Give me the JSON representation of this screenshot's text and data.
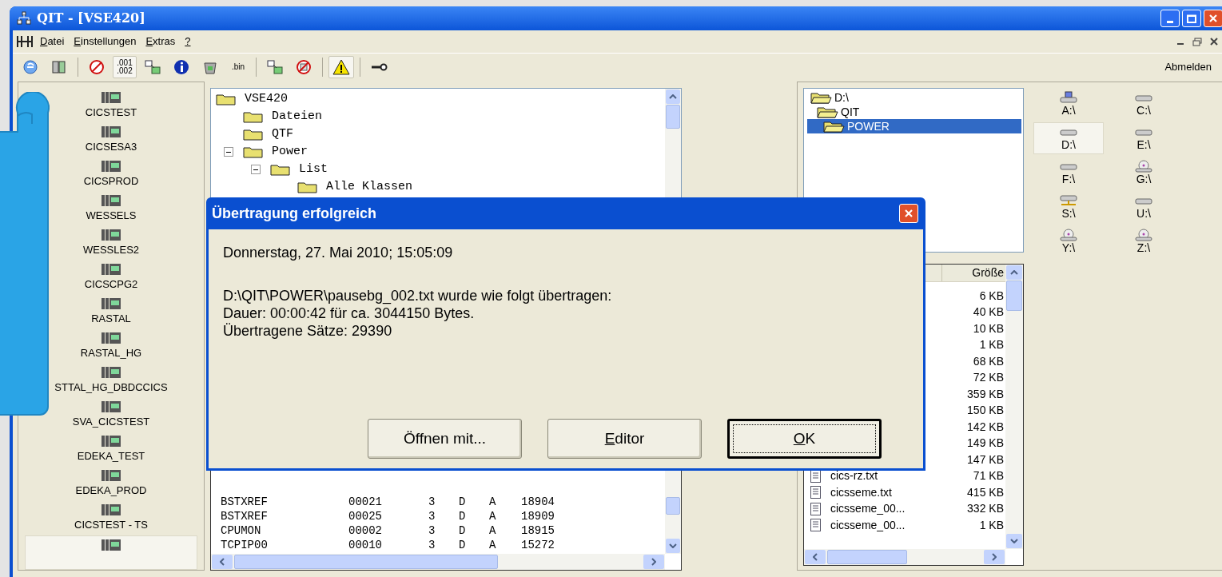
{
  "window": {
    "title": "QIT - [VSE420]"
  },
  "menu": [
    {
      "key": "D",
      "rest": "atei"
    },
    {
      "key": "E",
      "rest": "instellungen"
    },
    {
      "key": "E",
      "rest": "xtras"
    },
    {
      "key": "?"
    }
  ],
  "toolbar": [
    {
      "kind": "icon",
      "pressed": false
    },
    {
      "kind": "icon",
      "pressed": false
    },
    {
      "kind": "separator"
    },
    {
      "kind": "icon",
      "pressed": false
    },
    {
      "kind": "text",
      "label": ".001\n.002",
      "pressed": true
    },
    {
      "kind": "icon",
      "pressed": false
    },
    {
      "kind": "icon",
      "pressed": false
    },
    {
      "kind": "icon",
      "pressed": false
    },
    {
      "kind": "text",
      "label": ".bin",
      "pressed": false
    },
    {
      "kind": "separator"
    },
    {
      "kind": "icon",
      "pressed": false
    },
    {
      "kind": "icon",
      "pressed": false
    },
    {
      "kind": "separator"
    },
    {
      "kind": "icon",
      "pressed": true
    },
    {
      "kind": "separator"
    },
    {
      "kind": "icon",
      "pressed": false
    }
  ],
  "logout": "Abmelden",
  "systems": [
    {
      "label": "CICSTEST",
      "selected": false
    },
    {
      "label": "CICSESA3",
      "selected": false
    },
    {
      "label": "CICSPROD",
      "selected": false
    },
    {
      "label": "WESSELS",
      "selected": false
    },
    {
      "label": "WESSLES2",
      "selected": false
    },
    {
      "label": "CICSCPG2",
      "selected": false
    },
    {
      "label": "RASTAL",
      "selected": false
    },
    {
      "label": "RASTAL_HG",
      "selected": false
    },
    {
      "label": "STTAL_HG_DBDCCICS",
      "selected": false
    },
    {
      "label": "SVA_CICSTEST",
      "selected": false
    },
    {
      "label": "EDEKA_TEST",
      "selected": false
    },
    {
      "label": "EDEKA_PROD",
      "selected": false
    },
    {
      "label": "CICSTEST - TS",
      "selected": false
    },
    {
      "selected": true
    }
  ],
  "host_tree": [
    {
      "label": "VSE420",
      "children": [
        {
          "label": "Dateien"
        },
        {
          "label": "QTF"
        },
        {
          "label": "Power",
          "expanded": true,
          "children": [
            {
              "label": "List",
              "expanded": true,
              "children": [
                {
                  "label": "Alle Klassen"
                }
              ]
            }
          ]
        }
      ]
    }
  ],
  "queue_rows": [
    [
      "BSTXREF",
      "00021",
      "3",
      "D",
      "A",
      "18904"
    ],
    [
      "BSTXREF",
      "00025",
      "3",
      "D",
      "A",
      "18909"
    ],
    [
      "CPUMON",
      "00002",
      "3",
      "D",
      "A",
      "18915"
    ],
    [
      "TCPIP00",
      "00010",
      "3",
      "D",
      "A",
      "15272"
    ]
  ],
  "local_tree": [
    {
      "label": "D:\\",
      "selected": false
    },
    {
      "label": "QIT",
      "selected": false
    },
    {
      "label": "POWER",
      "selected": true
    }
  ],
  "drives": [
    {
      "label": "A:\\",
      "kind": "floppy",
      "selected": false
    },
    {
      "label": "C:\\",
      "kind": "disk",
      "selected": false
    },
    {
      "label": "D:\\",
      "kind": "disk",
      "selected": true
    },
    {
      "label": "E:\\",
      "kind": "disk",
      "selected": false
    },
    {
      "label": "F:\\",
      "kind": "disk",
      "selected": false
    },
    {
      "label": "G:\\",
      "kind": "cd",
      "selected": false
    },
    {
      "label": "S:\\",
      "kind": "network",
      "selected": false
    },
    {
      "label": "U:\\",
      "kind": "disk",
      "selected": false
    },
    {
      "label": "Y:\\",
      "kind": "cd",
      "selected": false
    },
    {
      "label": "Z:\\",
      "kind": "cd",
      "selected": false
    }
  ],
  "files": {
    "size_header": "Größe",
    "rows": [
      {
        "size": "6 KB"
      },
      {
        "size": "40 KB"
      },
      {
        "size": "10 KB"
      },
      {
        "size": "1 KB"
      },
      {
        "size": "68 KB"
      },
      {
        "size": "72 KB"
      },
      {
        "size": "359 KB"
      },
      {
        "size": "150 KB"
      },
      {
        "size": "142 KB"
      },
      {
        "size": "149 KB"
      },
      {
        "size": "147 KB"
      },
      {
        "name": "cics-rz.txt",
        "size": "71 KB"
      },
      {
        "name": "cicsseme.txt",
        "size": "415 KB"
      },
      {
        "name": "cicsseme_00...",
        "size": "332 KB"
      },
      {
        "name": "cicsseme_00...",
        "size": "1 KB"
      }
    ]
  },
  "dialog": {
    "title": "Übertragung erfolgreich",
    "timestamp": "Donnerstag, 27. Mai 2010; 15:05:09",
    "lines": [
      "D:\\QIT\\POWER\\pausebg_002.txt wurde wie folgt übertragen:",
      "Dauer: 00:00:42 für ca. 3044150 Bytes.",
      "Übertragene Sätze: 29390"
    ],
    "buttons": [
      {
        "label": "Öffnen mit...",
        "default": false
      },
      {
        "key": "E",
        "rest": "ditor",
        "default": false
      },
      {
        "key": "O",
        "rest": "K",
        "default": true
      }
    ]
  }
}
